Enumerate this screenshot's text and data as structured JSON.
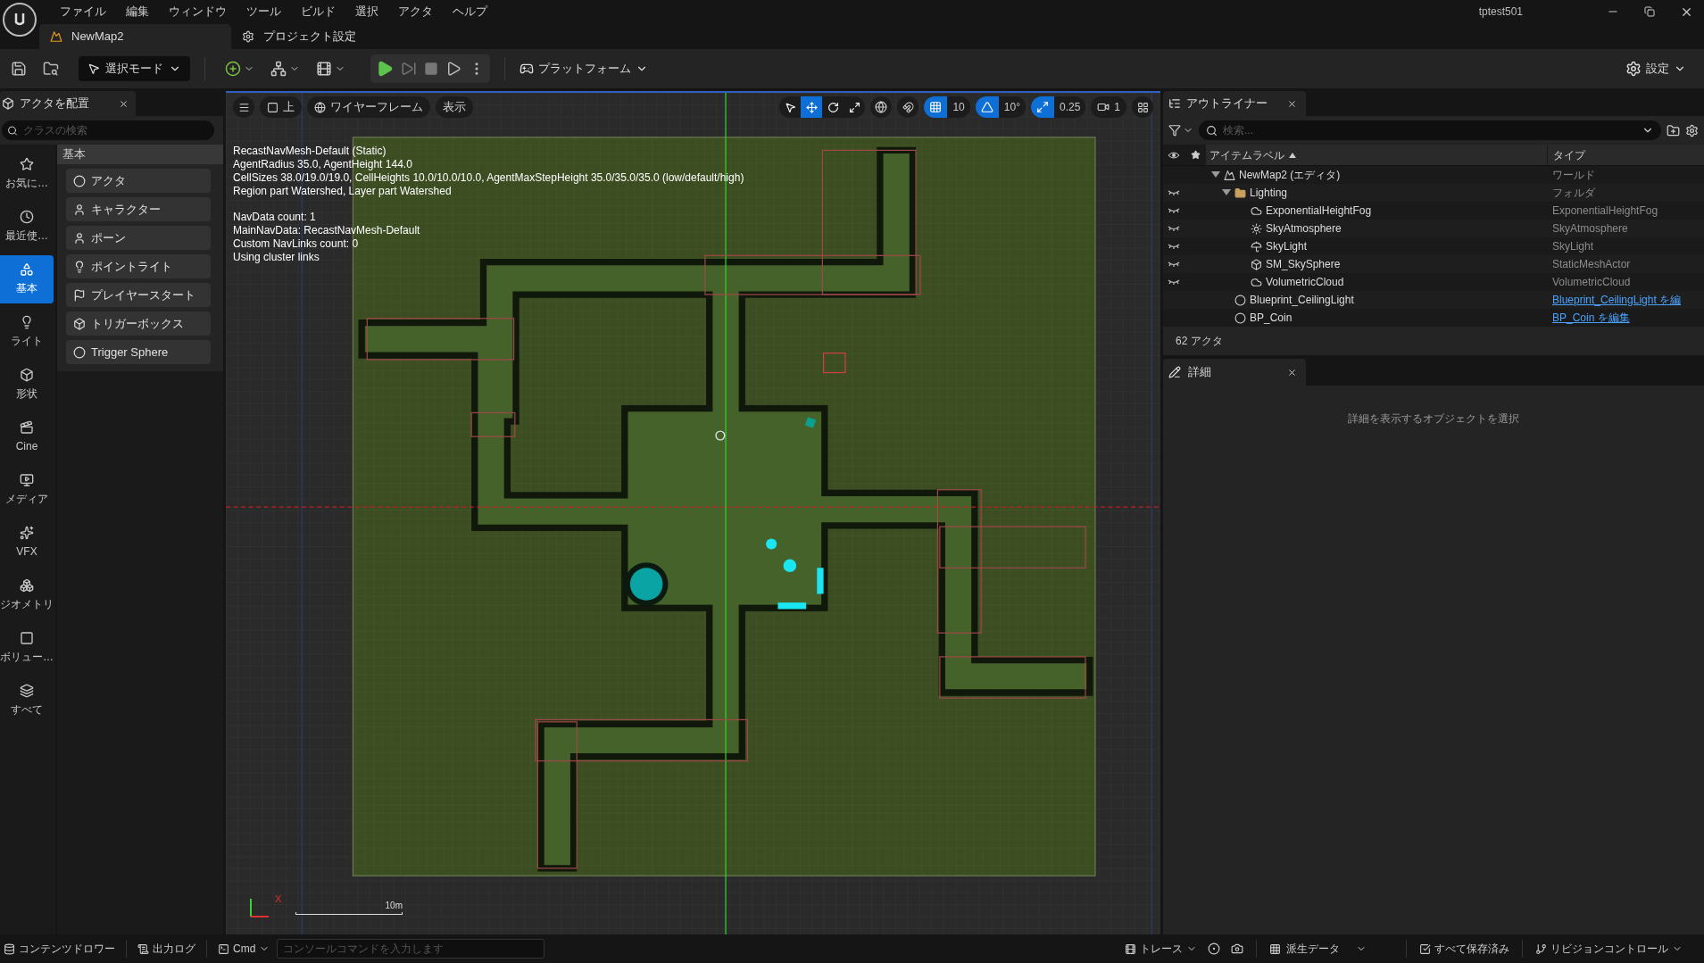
{
  "window": {
    "menu": [
      "ファイル",
      "編集",
      "ウィンドウ",
      "ツール",
      "ビルド",
      "選択",
      "アクタ",
      "ヘルプ"
    ],
    "project": "tptest501",
    "tabs": [
      {
        "label": "NewMap2",
        "selected": true
      },
      {
        "label": "プロジェクト設定",
        "selected": false
      }
    ]
  },
  "toolbar": {
    "mode": "選択モード",
    "platform": "プラットフォーム",
    "settings": "設定"
  },
  "place_actors": {
    "title": "アクタを配置",
    "search": {
      "placeholder": "クラスの検索"
    },
    "categories": [
      {
        "label": "お気に…",
        "selected": false
      },
      {
        "label": "最近使…",
        "selected": false
      },
      {
        "label": "基本",
        "selected": true
      },
      {
        "label": "ライト",
        "selected": false
      },
      {
        "label": "形状",
        "selected": false
      },
      {
        "label": "Cine",
        "selected": false
      },
      {
        "label": "メディア",
        "selected": false
      },
      {
        "label": "VFX",
        "selected": false
      },
      {
        "label": "ジオメトリ",
        "selected": false
      },
      {
        "label": "ボリュー…",
        "selected": false
      },
      {
        "label": "すべて",
        "selected": false
      }
    ],
    "section": "基本",
    "items": [
      "アクタ",
      "キャラクター",
      "ポーン",
      "ポイントライト",
      "プレイヤースタート",
      "トリガーボックス",
      "Trigger Sphere"
    ]
  },
  "viewport": {
    "view": "上",
    "view_mode": "ワイヤーフレーム",
    "show": "表示",
    "tools": [
      {
        "kind": "select",
        "selected": false
      },
      {
        "kind": "move",
        "selected": true
      },
      {
        "kind": "rotate",
        "selected": false
      },
      {
        "kind": "scale",
        "selected": false
      }
    ],
    "grid_snap": {
      "on": true,
      "value": "10"
    },
    "angle_snap": {
      "on": true,
      "value": "10°"
    },
    "scale_snap": {
      "on": true,
      "value": "0.25"
    },
    "camera_speed": "1",
    "stats": [
      [
        "RecastNavMesh-Default (Static)",
        "AgentRadius 35.0, AgentHeight 144.0",
        "CellSizes 38.0/19.0/19.0, CellHeights 10.0/10.0/10.0, AgentMaxStepHeight 35.0/35.0/35.0 (low/default/high)",
        "Region part Watershed, Layer part Watershed"
      ],
      [
        "NavData count: 1",
        "MainNavData: RecastNavMesh-Default",
        "Custom NavLinks count: 0",
        "Using cluster links"
      ]
    ],
    "scale_label": "10m",
    "axis_label": "X"
  },
  "outliner": {
    "title": "アウトライナー",
    "search": {
      "placeholder": "検索..."
    },
    "columns": [
      "アイテムラベル",
      "タイプ"
    ],
    "rows": [
      {
        "kind": "world",
        "label": "NewMap2 (エディタ)",
        "type": "ワールド",
        "type_link": false,
        "hidden": false,
        "expanded": true,
        "children": [
          {
            "kind": "folder",
            "label": "Lighting",
            "type": "フォルダ",
            "type_link": false,
            "hidden": true,
            "expanded": true,
            "children": [
              {
                "kind": "fog",
                "label": "ExponentialHeightFog",
                "type": "ExponentialHeightFog",
                "type_link": false,
                "hidden": true
              },
              {
                "kind": "atmosphere",
                "label": "SkyAtmosphere",
                "type": "SkyAtmosphere",
                "type_link": false,
                "hidden": true
              },
              {
                "kind": "skylight",
                "label": "SkyLight",
                "type": "SkyLight",
                "type_link": false,
                "hidden": true
              },
              {
                "kind": "mesh",
                "label": "SM_SkySphere",
                "type": "StaticMeshActor",
                "type_link": false,
                "hidden": true
              },
              {
                "kind": "cloud",
                "label": "VolumetricCloud",
                "type": "VolumetricCloud",
                "type_link": false,
                "hidden": true
              }
            ]
          },
          {
            "kind": "blueprint",
            "label": "Blueprint_CeilingLight",
            "type": "Blueprint_CeilingLight を編",
            "type_link": true,
            "hidden": false
          },
          {
            "kind": "blueprint",
            "label": "BP_Coin",
            "type": "BP_Coin を編集",
            "type_link": true,
            "hidden": false
          }
        ]
      }
    ],
    "count": "62 アクタ"
  },
  "details": {
    "title": "詳細",
    "empty": "詳細を表示するオブジェクトを選択"
  },
  "status_bar": {
    "content_drawer": "コンテンツドロワー",
    "output_log": "出力ログ",
    "cmd": "Cmd",
    "console": {
      "placeholder": "コンソールコマンドを入力します"
    },
    "trace": "トレース",
    "derived_data": "派生データ",
    "save_status": "すべて保存済み",
    "revision": "リビジョンコントロール"
  }
}
